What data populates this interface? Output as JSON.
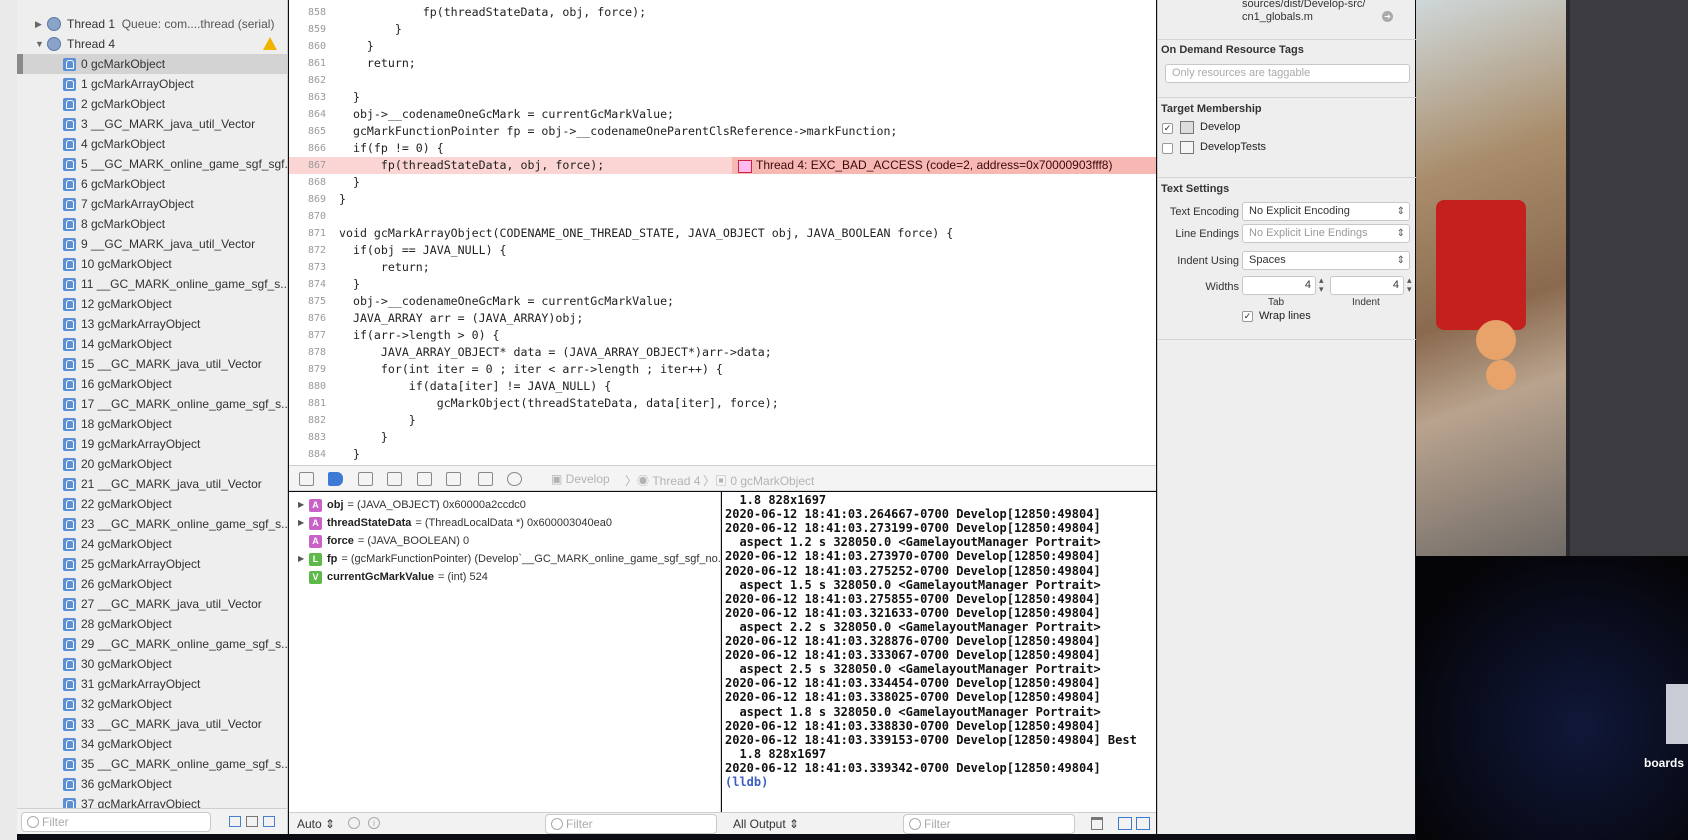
{
  "navigator": {
    "thread1_label": "Thread 1",
    "thread1_queue": "Queue: com....thread (serial)",
    "thread4_label": "Thread 4",
    "frames": [
      "0 gcMarkObject",
      "1 gcMarkArrayObject",
      "2 gcMarkObject",
      "3 __GC_MARK_java_util_Vector",
      "4 gcMarkObject",
      "5 __GC_MARK_online_game_sgf_sgf...",
      "6 gcMarkObject",
      "7 gcMarkArrayObject",
      "8 gcMarkObject",
      "9 __GC_MARK_java_util_Vector",
      "10 gcMarkObject",
      "11 __GC_MARK_online_game_sgf_s...",
      "12 gcMarkObject",
      "13 gcMarkArrayObject",
      "14 gcMarkObject",
      "15 __GC_MARK_java_util_Vector",
      "16 gcMarkObject",
      "17 __GC_MARK_online_game_sgf_s...",
      "18 gcMarkObject",
      "19 gcMarkArrayObject",
      "20 gcMarkObject",
      "21 __GC_MARK_java_util_Vector",
      "22 gcMarkObject",
      "23 __GC_MARK_online_game_sgf_s...",
      "24 gcMarkObject",
      "25 gcMarkArrayObject",
      "26 gcMarkObject",
      "27 __GC_MARK_java_util_Vector",
      "28 gcMarkObject",
      "29 __GC_MARK_online_game_sgf_s...",
      "30 gcMarkObject",
      "31 gcMarkArrayObject",
      "32 gcMarkObject",
      "33 __GC_MARK_java_util_Vector",
      "34 gcMarkObject",
      "35 __GC_MARK_online_game_sgf_s...",
      "36 gcMarkObject",
      "37 gcMarkArrayObject"
    ],
    "filter_placeholder": "Filter"
  },
  "editor": {
    "lines": [
      {
        "n": "858",
        "code": "            fp(threadStateData, obj, force);"
      },
      {
        "n": "859",
        "code": "        }"
      },
      {
        "n": "860",
        "code": "    }"
      },
      {
        "n": "861",
        "code": "    return;"
      },
      {
        "n": "862",
        "code": ""
      },
      {
        "n": "863",
        "code": "  }"
      },
      {
        "n": "864",
        "code": "  obj->__codenameOneGcMark = currentGcMarkValue;"
      },
      {
        "n": "865",
        "code": "  gcMarkFunctionPointer fp = obj->__codenameOneParentClsReference->markFunction;"
      },
      {
        "n": "866",
        "code": "  if(fp != 0) {"
      },
      {
        "n": "867",
        "code": "      fp(threadStateData, obj, force);"
      },
      {
        "n": "868",
        "code": "  }"
      },
      {
        "n": "869",
        "code": "}"
      },
      {
        "n": "870",
        "code": ""
      },
      {
        "n": "871",
        "code": "void gcMarkArrayObject(CODENAME_ONE_THREAD_STATE, JAVA_OBJECT obj, JAVA_BOOLEAN force) {"
      },
      {
        "n": "872",
        "code": "  if(obj == JAVA_NULL) {"
      },
      {
        "n": "873",
        "code": "      return;"
      },
      {
        "n": "874",
        "code": "  }"
      },
      {
        "n": "875",
        "code": "  obj->__codenameOneGcMark = currentGcMarkValue;"
      },
      {
        "n": "876",
        "code": "  JAVA_ARRAY arr = (JAVA_ARRAY)obj;"
      },
      {
        "n": "877",
        "code": "  if(arr->length > 0) {"
      },
      {
        "n": "878",
        "code": "      JAVA_ARRAY_OBJECT* data = (JAVA_ARRAY_OBJECT*)arr->data;"
      },
      {
        "n": "879",
        "code": "      for(int iter = 0 ; iter < arr->length ; iter++) {"
      },
      {
        "n": "880",
        "code": "          if(data[iter] != JAVA_NULL) {"
      },
      {
        "n": "881",
        "code": "              gcMarkObject(threadStateData, data[iter], force);"
      },
      {
        "n": "882",
        "code": "          }"
      },
      {
        "n": "883",
        "code": "      }"
      },
      {
        "n": "884",
        "code": "  }"
      }
    ],
    "error_message": "Thread 4: EXC_BAD_ACCESS (code=2, address=0x70000903fff8)"
  },
  "debugbar": {
    "crumb1": "Develop",
    "crumb2": "Thread 4",
    "crumb3": "0 gcMarkObject"
  },
  "variables": [
    {
      "kind": "A",
      "name": "obj",
      "value": "= (JAVA_OBJECT) 0x60000a2ccdc0"
    },
    {
      "kind": "A",
      "name": "threadStateData",
      "value": "= (ThreadLocalData *) 0x600003040ea0"
    },
    {
      "kind": "A",
      "name": "force",
      "value": "= (JAVA_BOOLEAN) 0"
    },
    {
      "kind": "L",
      "name": "fp",
      "value": "= (gcMarkFunctionPointer) (Develop`__GC_MARK_online_game_sgf_sgf_no..."
    },
    {
      "kind": "V",
      "name": "currentGcMarkValue",
      "value": "= (int) 524"
    }
  ],
  "console": [
    "  1.8 828x1697",
    "2020-06-12 18:41:03.264667-0700 Develop[12850:49804]",
    "2020-06-12 18:41:03.273199-0700 Develop[12850:49804]",
    "  aspect 1.2 s 328050.0 <GamelayoutManager Portrait>",
    "2020-06-12 18:41:03.273970-0700 Develop[12850:49804]",
    "2020-06-12 18:41:03.275252-0700 Develop[12850:49804]",
    "  aspect 1.5 s 328050.0 <GamelayoutManager Portrait>",
    "2020-06-12 18:41:03.275855-0700 Develop[12850:49804]",
    "2020-06-12 18:41:03.321633-0700 Develop[12850:49804]",
    "  aspect 2.2 s 328050.0 <GamelayoutManager Portrait>",
    "2020-06-12 18:41:03.328876-0700 Develop[12850:49804]",
    "2020-06-12 18:41:03.333067-0700 Develop[12850:49804]",
    "  aspect 2.5 s 328050.0 <GamelayoutManager Portrait>",
    "2020-06-12 18:41:03.334454-0700 Develop[12850:49804]",
    "2020-06-12 18:41:03.338025-0700 Develop[12850:49804]",
    "  aspect 1.8 s 328050.0 <GamelayoutManager Portrait>",
    "2020-06-12 18:41:03.338830-0700 Develop[12850:49804]",
    "2020-06-12 18:41:03.339153-0700 Develop[12850:49804] Best",
    "  1.8 828x1697",
    "2020-06-12 18:41:03.339342-0700 Develop[12850:49804]",
    "(lldb)"
  ],
  "bottombar": {
    "auto_label": "Auto",
    "vars_filter_placeholder": "Filter",
    "output_label": "All Output",
    "console_filter_placeholder": "Filter"
  },
  "inspector": {
    "path_line1": "sources/dist/Develop-src/",
    "path_line2": "cn1_globals.m",
    "odr_title": "On Demand Resource Tags",
    "odr_placeholder": "Only resources are taggable",
    "target_title": "Target Membership",
    "target1": "Develop",
    "target2": "DevelopTests",
    "text_title": "Text Settings",
    "encoding_label": "Text Encoding",
    "encoding_value": "No Explicit Encoding",
    "endings_label": "Line Endings",
    "endings_value": "No Explicit Line Endings",
    "indent_label": "Indent Using",
    "indent_value": "Spaces",
    "widths_label": "Widths",
    "tab_value": "4",
    "indent_width_value": "4",
    "tab_caption": "Tab",
    "indent_caption": "Indent",
    "wrap_label": "Wrap lines"
  },
  "desktop": {
    "label": "boards"
  }
}
